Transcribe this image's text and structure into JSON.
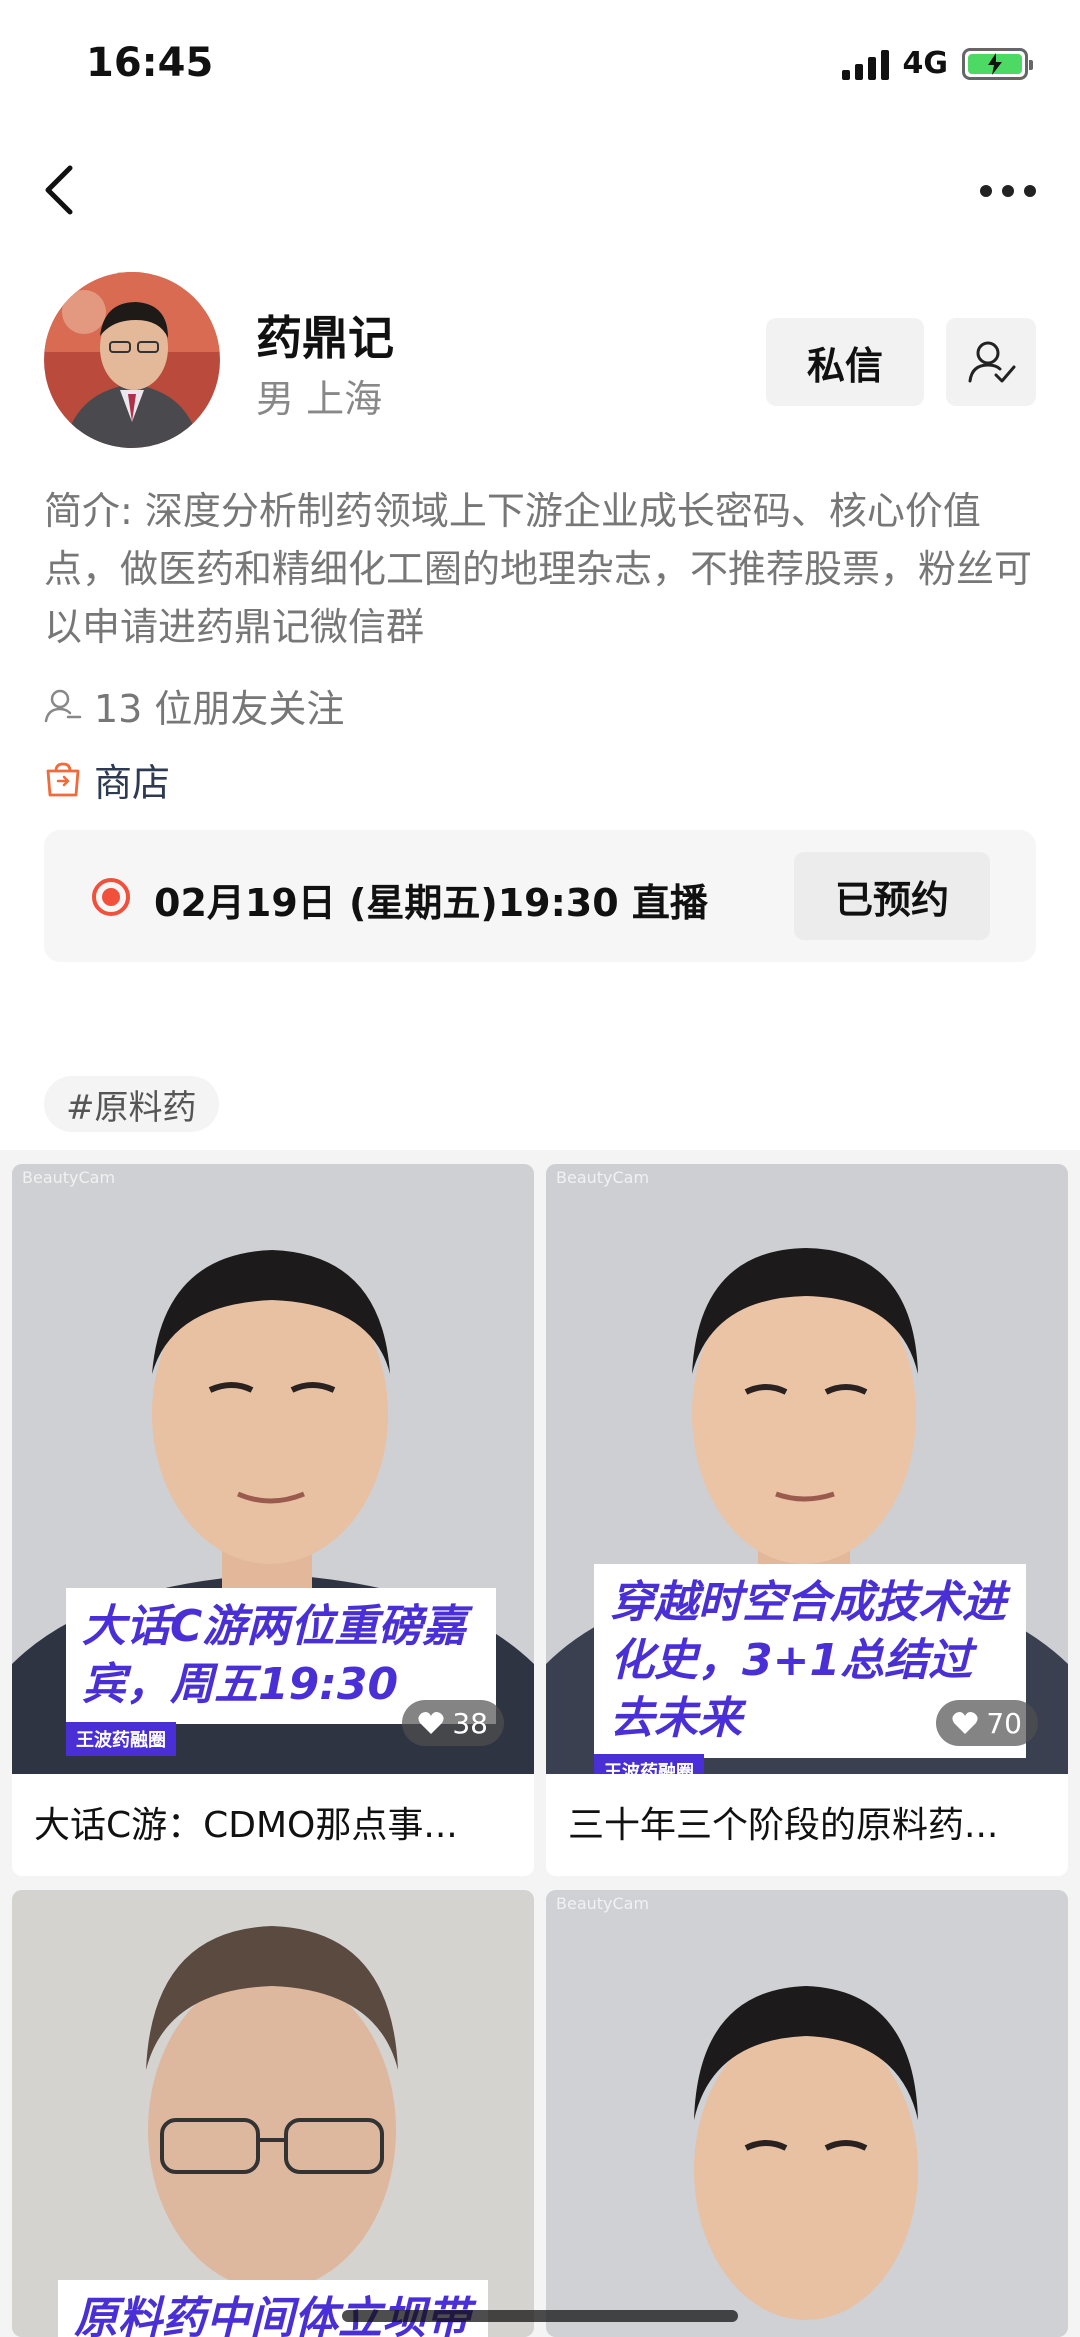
{
  "status_bar": {
    "time": "16:45",
    "network": "4G",
    "battery": "charging"
  },
  "nav": {
    "back_icon": "chevron-left-icon",
    "more_icon": "more-horizontal-icon"
  },
  "profile": {
    "name": "药鼎记",
    "meta": "男 上海",
    "dm_label": "私信",
    "follow_icon": "user-check-icon",
    "bio": "简介: 深度分析制药领域上下游企业成长密码、核心价值点，做医药和精细化工圈的地理杂志，不推荐股票，粉丝可以申请进药鼎记微信群",
    "friends_text": "13 位朋友关注",
    "shop_label": "商店"
  },
  "live": {
    "text": "02月19日 (星期五)19:30 直播",
    "button_label": "已预约"
  },
  "tag": "#原料药",
  "posts": [
    {
      "overlay": "大话C游两位重磅嘉宾，周五19:30",
      "brand": "王波药融圈",
      "likes": "38",
      "title": "大话C游：CDMO那点事...",
      "watermark": "BeautyCam"
    },
    {
      "overlay": "穿越时空合成技术进化史，3+1总结过去未来",
      "brand": "王波药融圈",
      "likes": "70",
      "title": "三十年三个阶段的原料药...",
      "watermark": "BeautyCam"
    },
    {
      "overlay": "原料药中间体立坝带",
      "brand": "",
      "likes": "",
      "title": "",
      "watermark": ""
    },
    {
      "overlay": "",
      "brand": "",
      "likes": "",
      "title": "",
      "watermark": "BeautyCam"
    }
  ],
  "colors": {
    "accent_purple": "#4b2fd6",
    "live_red": "#f0503c",
    "shop_orange": "#f06a3c"
  }
}
